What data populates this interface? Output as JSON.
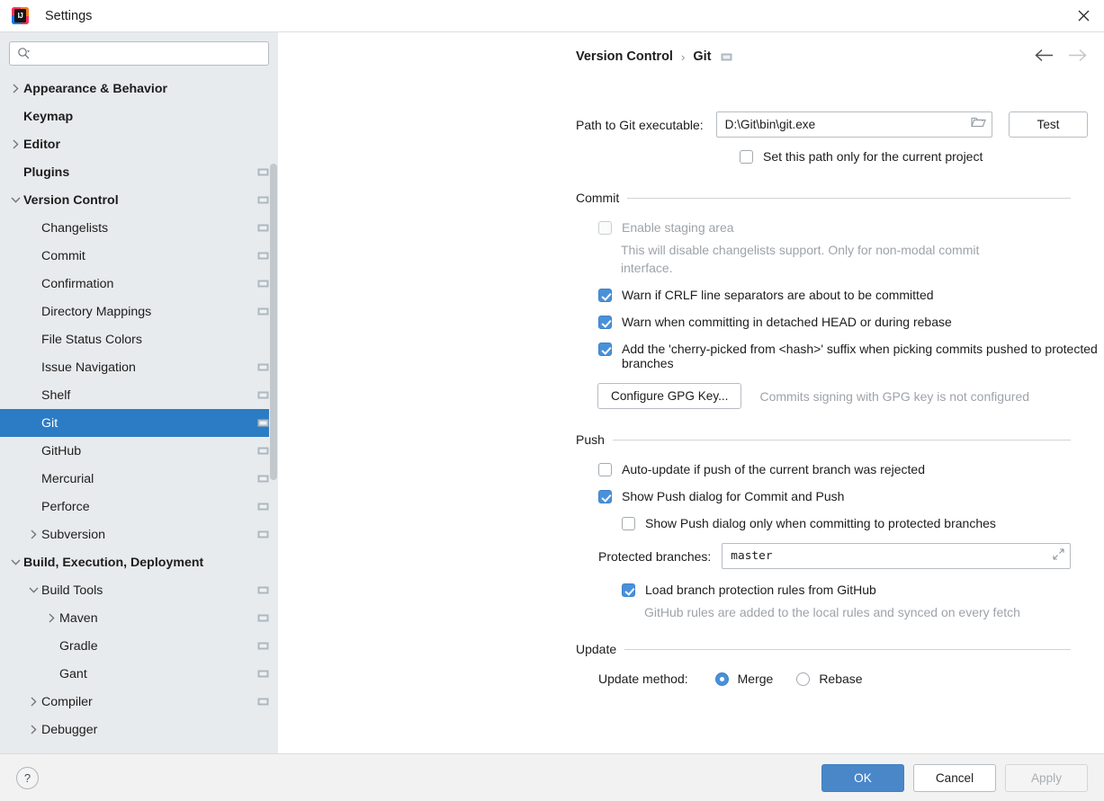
{
  "window": {
    "title": "Settings",
    "logo_text": "IJ",
    "close_icon": "close-icon"
  },
  "sidebar": {
    "search": {
      "placeholder": "",
      "value": "",
      "icon": "search-icon"
    },
    "items": [
      {
        "label": "Appearance & Behavior",
        "indent": 0,
        "bold": true,
        "twisty": "right",
        "badge": false,
        "selected": false
      },
      {
        "label": "Keymap",
        "indent": 0,
        "bold": true,
        "twisty": "none",
        "badge": false,
        "selected": false
      },
      {
        "label": "Editor",
        "indent": 0,
        "bold": true,
        "twisty": "right",
        "badge": false,
        "selected": false
      },
      {
        "label": "Plugins",
        "indent": 0,
        "bold": true,
        "twisty": "none",
        "badge": true,
        "selected": false
      },
      {
        "label": "Version Control",
        "indent": 0,
        "bold": true,
        "twisty": "down",
        "badge": true,
        "selected": false
      },
      {
        "label": "Changelists",
        "indent": 1,
        "bold": false,
        "twisty": "none",
        "badge": true,
        "selected": false
      },
      {
        "label": "Commit",
        "indent": 1,
        "bold": false,
        "twisty": "none",
        "badge": true,
        "selected": false
      },
      {
        "label": "Confirmation",
        "indent": 1,
        "bold": false,
        "twisty": "none",
        "badge": true,
        "selected": false
      },
      {
        "label": "Directory Mappings",
        "indent": 1,
        "bold": false,
        "twisty": "none",
        "badge": true,
        "selected": false
      },
      {
        "label": "File Status Colors",
        "indent": 1,
        "bold": false,
        "twisty": "none",
        "badge": false,
        "selected": false
      },
      {
        "label": "Issue Navigation",
        "indent": 1,
        "bold": false,
        "twisty": "none",
        "badge": true,
        "selected": false
      },
      {
        "label": "Shelf",
        "indent": 1,
        "bold": false,
        "twisty": "none",
        "badge": true,
        "selected": false
      },
      {
        "label": "Git",
        "indent": 1,
        "bold": false,
        "twisty": "none",
        "badge": true,
        "selected": true
      },
      {
        "label": "GitHub",
        "indent": 1,
        "bold": false,
        "twisty": "none",
        "badge": true,
        "selected": false
      },
      {
        "label": "Mercurial",
        "indent": 1,
        "bold": false,
        "twisty": "none",
        "badge": true,
        "selected": false
      },
      {
        "label": "Perforce",
        "indent": 1,
        "bold": false,
        "twisty": "none",
        "badge": true,
        "selected": false
      },
      {
        "label": "Subversion",
        "indent": 1,
        "bold": false,
        "twisty": "right",
        "badge": true,
        "selected": false
      },
      {
        "label": "Build, Execution, Deployment",
        "indent": 0,
        "bold": true,
        "twisty": "down",
        "badge": false,
        "selected": false
      },
      {
        "label": "Build Tools",
        "indent": 1,
        "bold": false,
        "twisty": "down",
        "badge": true,
        "selected": false
      },
      {
        "label": "Maven",
        "indent": 2,
        "bold": false,
        "twisty": "right",
        "badge": true,
        "selected": false
      },
      {
        "label": "Gradle",
        "indent": 2,
        "bold": false,
        "twisty": "none",
        "badge": true,
        "selected": false
      },
      {
        "label": "Gant",
        "indent": 2,
        "bold": false,
        "twisty": "none",
        "badge": true,
        "selected": false
      },
      {
        "label": "Compiler",
        "indent": 1,
        "bold": false,
        "twisty": "right",
        "badge": true,
        "selected": false
      },
      {
        "label": "Debugger",
        "indent": 1,
        "bold": false,
        "twisty": "right",
        "badge": false,
        "selected": false
      }
    ]
  },
  "header": {
    "breadcrumb_root": "Version Control",
    "breadcrumb_sep": "›",
    "breadcrumb_current": "Git",
    "breadcrumb_icon": "module-badge-icon",
    "back_icon": "arrow-left-icon",
    "forward_icon": "arrow-right-icon"
  },
  "main": {
    "path": {
      "label": "Path to Git executable:",
      "value": "D:\\Git\\bin\\git.exe",
      "browse_icon": "folder-icon",
      "test_button": "Test"
    },
    "set_path_only_project": {
      "label": "Set this path only for the current project",
      "checked": false
    },
    "commit": {
      "section_title": "Commit",
      "enable_staging": {
        "label": "Enable staging area",
        "checked": false,
        "disabled": true,
        "hint_line1": "This will disable changelists support. Only for non-modal commit",
        "hint_line2": "interface."
      },
      "checkboxes": [
        {
          "label": "Warn if CRLF line separators are about to be committed",
          "checked": true
        },
        {
          "label": "Warn when committing in detached HEAD or during rebase",
          "checked": true
        },
        {
          "label": "Add the 'cherry-picked from <hash>' suffix when picking commits pushed to protected branches",
          "checked": true
        }
      ],
      "gpg_button": "Configure GPG Key...",
      "gpg_status": "Commits signing with GPG key is not configured"
    },
    "push": {
      "section_title": "Push",
      "auto_update": {
        "label": "Auto-update if push of the current branch was rejected",
        "checked": false
      },
      "show_push_dialog": {
        "label": "Show Push dialog for Commit and Push",
        "checked": true
      },
      "show_push_protected": {
        "label": "Show Push dialog only when committing to protected branches",
        "checked": false
      },
      "protected_branches": {
        "label": "Protected branches:",
        "value": "master",
        "expand_icon": "expand-icon"
      },
      "load_github_rules": {
        "label": "Load branch protection rules from GitHub",
        "checked": true
      },
      "github_hint": "GitHub rules are added to the local rules and synced on every fetch"
    },
    "update": {
      "section_title": "Update",
      "method_label": "Update method:",
      "options": [
        {
          "label": "Merge",
          "selected": true
        },
        {
          "label": "Rebase",
          "selected": false
        }
      ]
    }
  },
  "footer": {
    "help_label": "?",
    "ok_label": "OK",
    "cancel_label": "Cancel",
    "apply_label": "Apply",
    "apply_disabled": true
  },
  "colors": {
    "selection_blue": "#2b7cc4",
    "primary_blue": "#4a87c8",
    "checkbox_blue": "#4a90d9",
    "sidebar_bg": "#e8ebed",
    "content_bg": "#ffffff",
    "footer_bg": "#f2f2f2",
    "muted_text": "#9ea3a9"
  }
}
